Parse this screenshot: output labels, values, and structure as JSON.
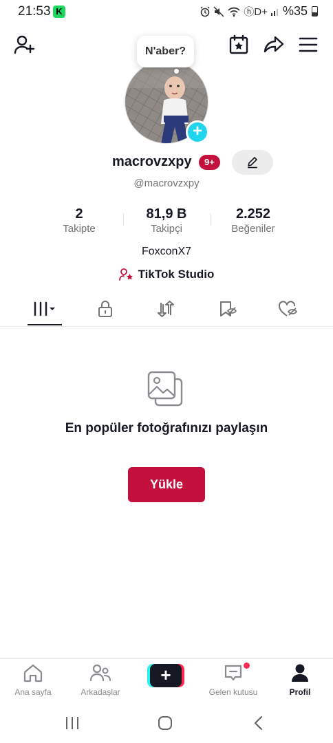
{
  "status_bar": {
    "time": "21:53",
    "app_icon_letter": "K",
    "network": "ⓗD+",
    "battery": "%35"
  },
  "profile_bubble": "N'aber?",
  "profile": {
    "username": "macrovzxpy",
    "badge": "9+",
    "handle": "@macrovzxpy",
    "bio": "FoxconX7",
    "studio_label": "TikTok Studio"
  },
  "stats": [
    {
      "value": "2",
      "label": "Takipte"
    },
    {
      "value": "81,9 B",
      "label": "Takipçi"
    },
    {
      "value": "2.252",
      "label": "Beğeniler"
    }
  ],
  "empty_state": {
    "title": "En popüler fotoğrafınızı paylaşın",
    "button": "Yükle"
  },
  "bottom_nav": [
    {
      "label": "Ana sayfa",
      "icon": "home-icon"
    },
    {
      "label": "Arkadaşlar",
      "icon": "friends-icon"
    },
    {
      "label": "Gelen kutusu",
      "icon": "inbox-icon"
    },
    {
      "label": "Profil",
      "icon": "profile-icon"
    }
  ],
  "colors": {
    "brand_red": "#c4103c",
    "avatar_add": "#20d5ec",
    "tiktok_cyan": "#25f4ee",
    "tiktok_pink": "#fe2c55"
  }
}
